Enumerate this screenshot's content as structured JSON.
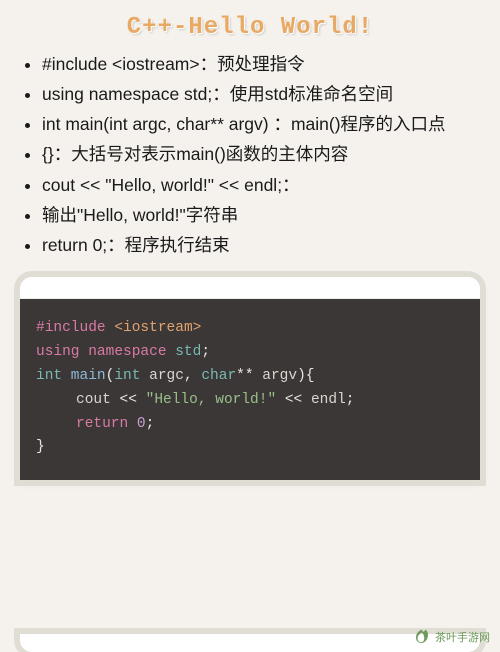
{
  "title": "C++-Hello World!",
  "bullets": [
    "#include <iostream>：预处理指令",
    "using namespace std;：使用std标准命名空间",
    "int main(int argc, char** argv) ：main()程序的入口点",
    "{}：大括号对表示main()函数的主体内容",
    "cout   <<   \"Hello,   world!\"   <<   endl;：",
    "输出\"Hello, world!\"字符串",
    "return 0;：程序执行结束"
  ],
  "code": {
    "l1_include": "#include",
    "l1_header": " <iostream>",
    "l2_using": "using",
    "l2_ns": " namespace",
    "l2_std": " std",
    "l2_semi": ";",
    "l3_int": "int",
    "l3_main": " main",
    "l3_p1": "(",
    "l3_int2": "int",
    "l3_argc": " argc",
    "l3_comma": ", ",
    "l3_char": "char",
    "l3_stars": "** ",
    "l3_argv": "argv",
    "l3_p2": "){",
    "l4_cout": "cout ",
    "l4_op1": "<< ",
    "l4_str": "\"Hello, world!\"",
    "l4_op2": " << ",
    "l4_endl": "endl",
    "l4_semi": ";",
    "l5_return": "return",
    "l5_sp": " ",
    "l5_zero": "0",
    "l5_semi": ";",
    "l6_close": "}"
  },
  "watermark": "茶叶手游网"
}
